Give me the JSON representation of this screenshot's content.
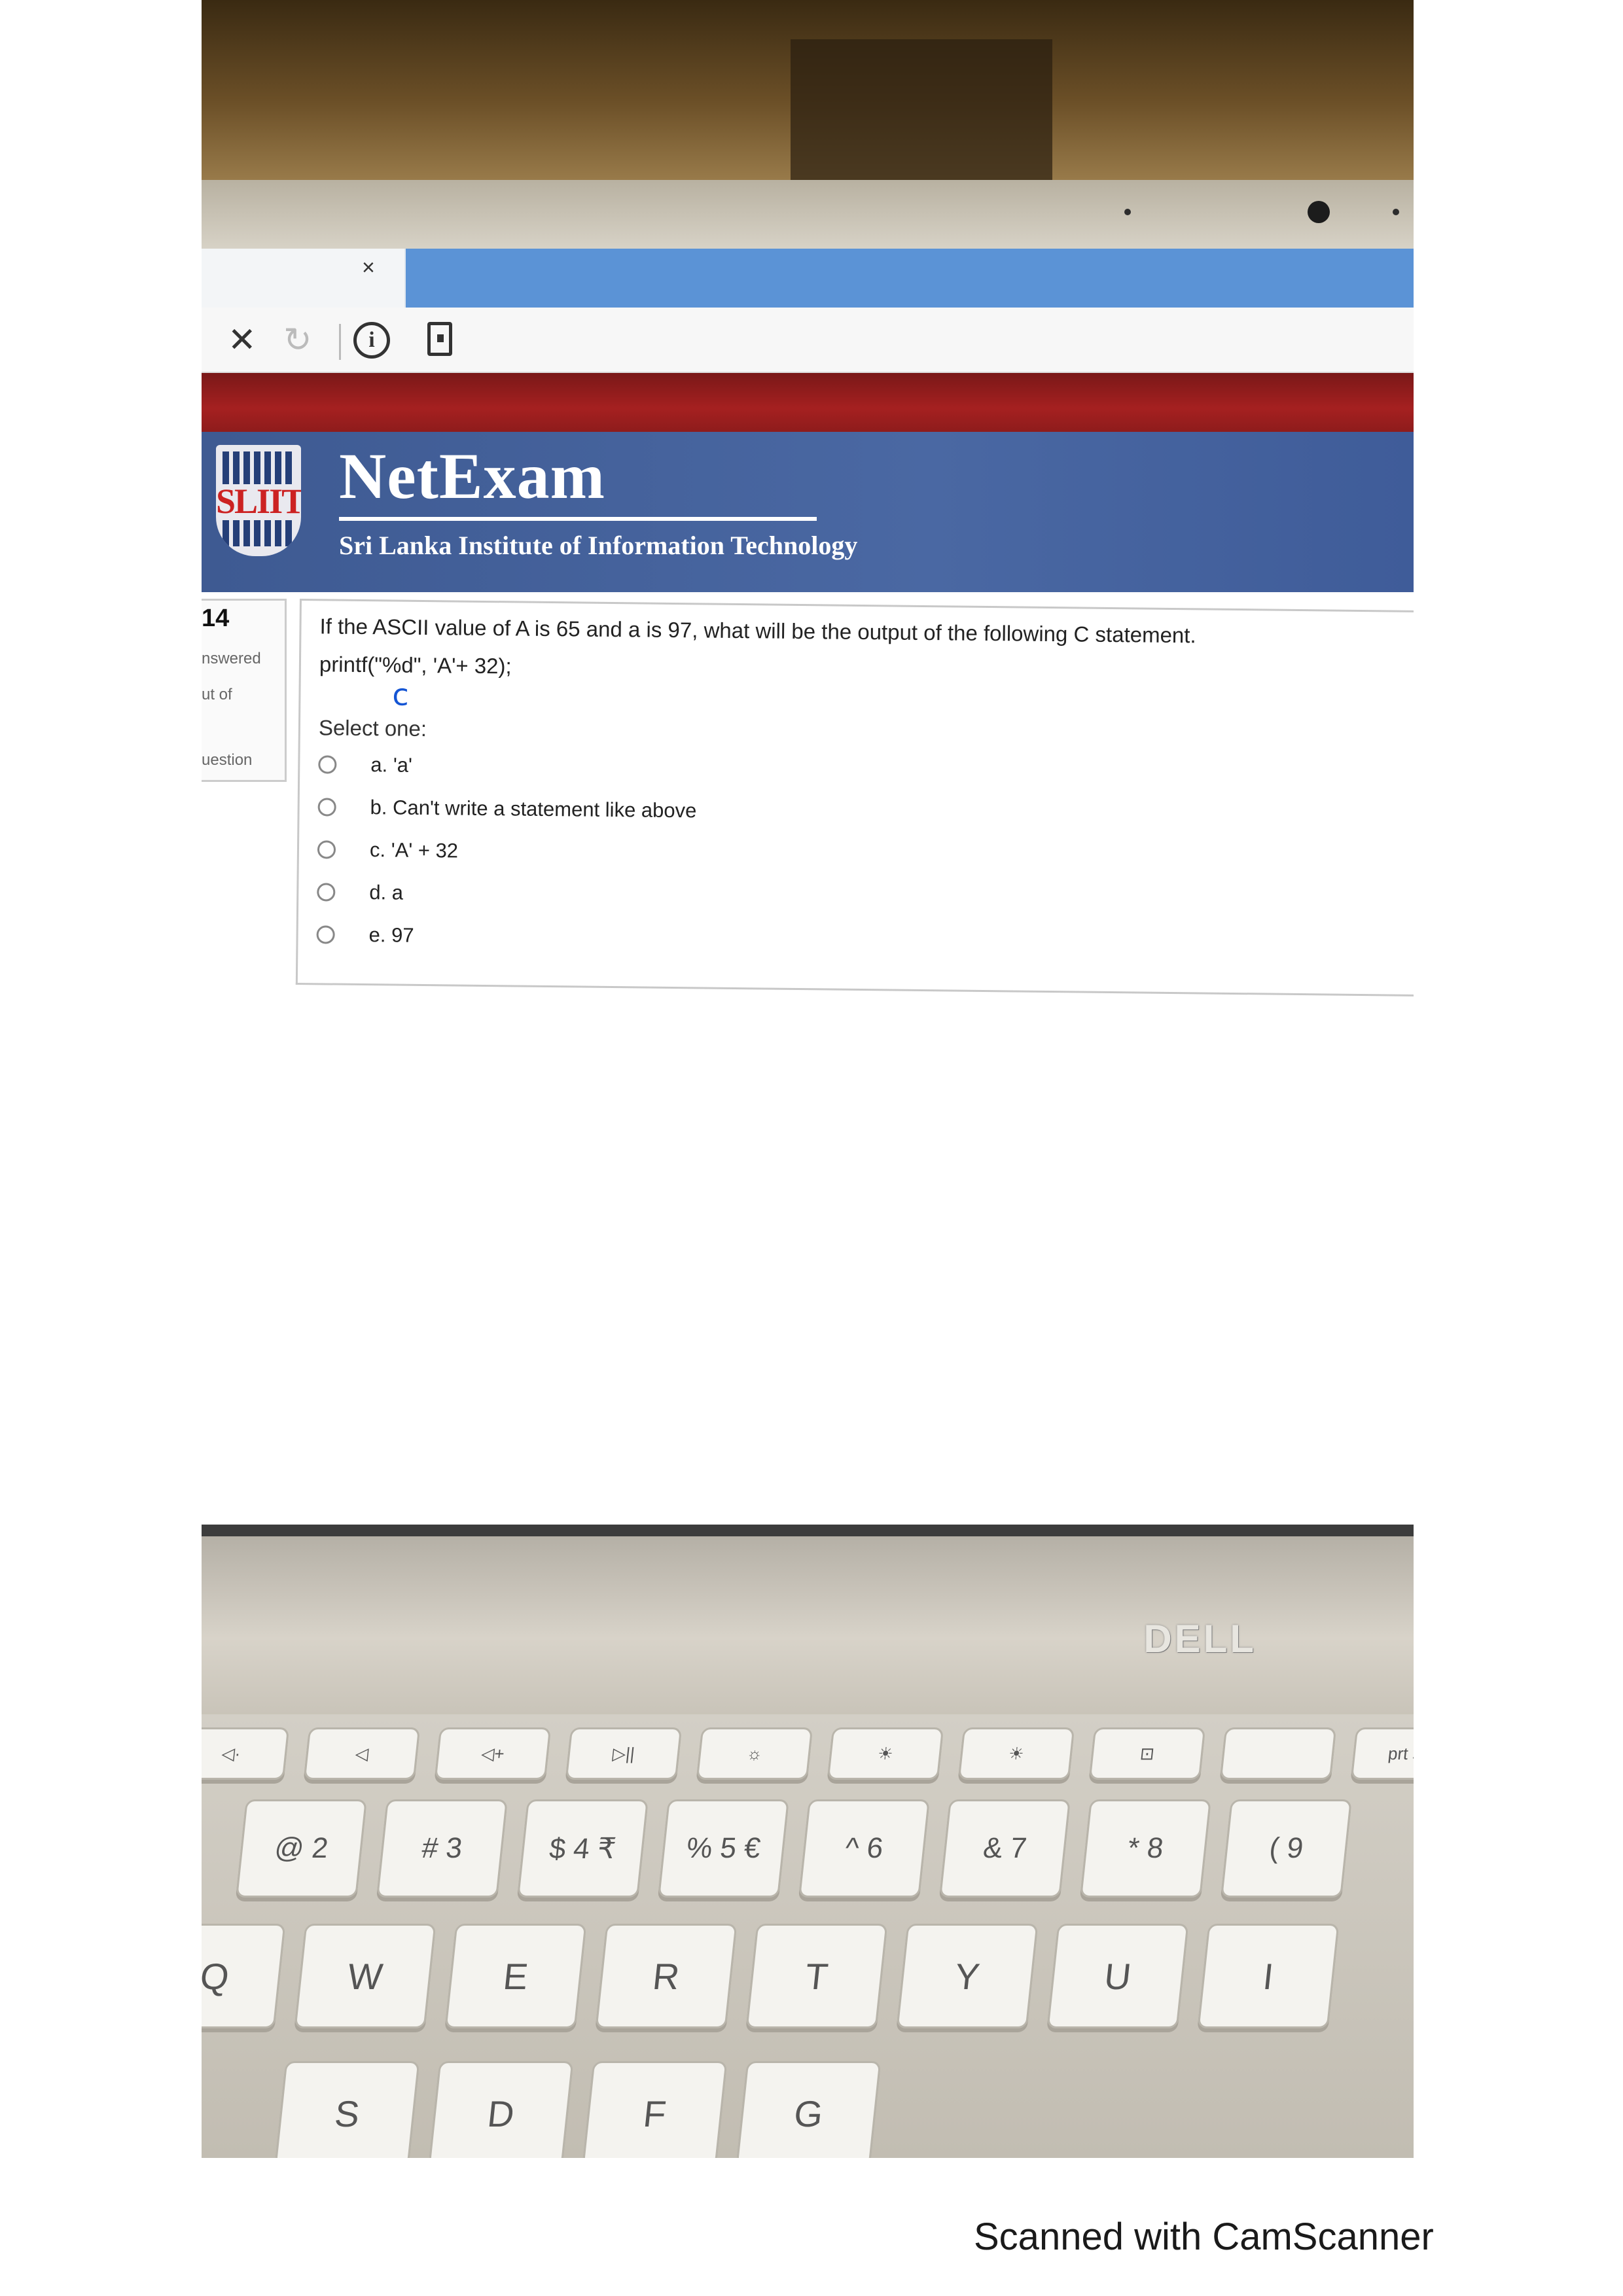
{
  "browser": {
    "tab_close_glyph": "×",
    "stop_glyph": "✕",
    "reload_glyph": "↻",
    "info_glyph": "i"
  },
  "header": {
    "logo_text": "SLIIT",
    "brand": "NetExam",
    "subtitle": "Sri Lanka Institute of Information Technology",
    "colors": {
      "header_bg": "#4a68a3",
      "top_band": "#a52020"
    }
  },
  "nav": {
    "question_number": "14",
    "lines": [
      "nswered",
      "ut of",
      "uestion"
    ]
  },
  "question": {
    "text": "If the ASCII value of A is 65 and a is 97, what will be the output of the following C statement.",
    "code": "printf(\"%d\", 'A'+ 32);",
    "handwritten_mark": "c",
    "prompt": "Select one:",
    "options": [
      "a. 'a'",
      "b. Can't write a statement like above",
      "c. 'A' + 32",
      "d. a",
      "e. 97"
    ],
    "selected": null
  },
  "laptop": {
    "brand": "DELL"
  },
  "keyboard": {
    "function_row": [
      "◁·",
      "◁",
      "◁+",
      "▷||",
      "☼",
      "☀",
      "☀",
      "⊡",
      "",
      "prt sc"
    ],
    "number_row": [
      "@ 2",
      "# 3",
      "$ 4 ₹",
      "% 5 €",
      "^ 6",
      "& 7",
      "* 8",
      "( 9"
    ],
    "qwerty_row": [
      "Q",
      "W",
      "E",
      "R",
      "T",
      "Y",
      "U",
      "I"
    ],
    "home_row": [
      "S",
      "D",
      "F",
      "G"
    ]
  },
  "footer": {
    "watermark": "Scanned with CamScanner"
  }
}
